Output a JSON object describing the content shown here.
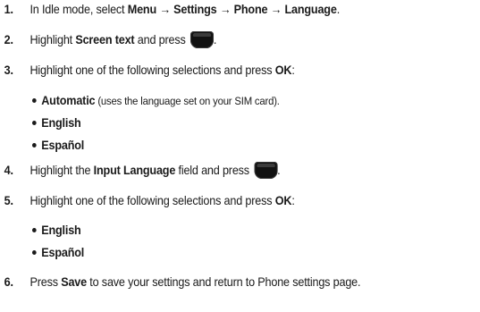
{
  "steps": [
    {
      "num": "1.",
      "parts": [
        "In Idle mode, select ",
        "Menu",
        " → ",
        "Settings",
        " → ",
        "Phone",
        " → ",
        "Language",
        "."
      ]
    },
    {
      "num": "2.",
      "parts": [
        "Highlight ",
        "Screen text",
        " and press ",
        "."
      ]
    },
    {
      "num": "3.",
      "parts": [
        "Highlight one of the following selections and press ",
        "OK",
        ":"
      ]
    },
    {
      "num": "4.",
      "parts": [
        "Highlight the ",
        "Input Language",
        " field and press ",
        "."
      ]
    },
    {
      "num": "5.",
      "parts": [
        "Highlight one of the following selections and press ",
        "OK",
        ":"
      ]
    },
    {
      "num": "6.",
      "parts": [
        "Press ",
        "Save",
        " to save your settings and return to Phone settings page."
      ]
    }
  ],
  "screen_text_options": [
    {
      "label": "Automatic",
      "note": " (uses the language set on your SIM card)."
    },
    {
      "label": "English",
      "note": ""
    },
    {
      "label": "Español",
      "note": ""
    }
  ],
  "input_language_options": [
    {
      "label": "English"
    },
    {
      "label": "Español"
    }
  ],
  "icons": {
    "select_key": "select-softkey-icon"
  }
}
